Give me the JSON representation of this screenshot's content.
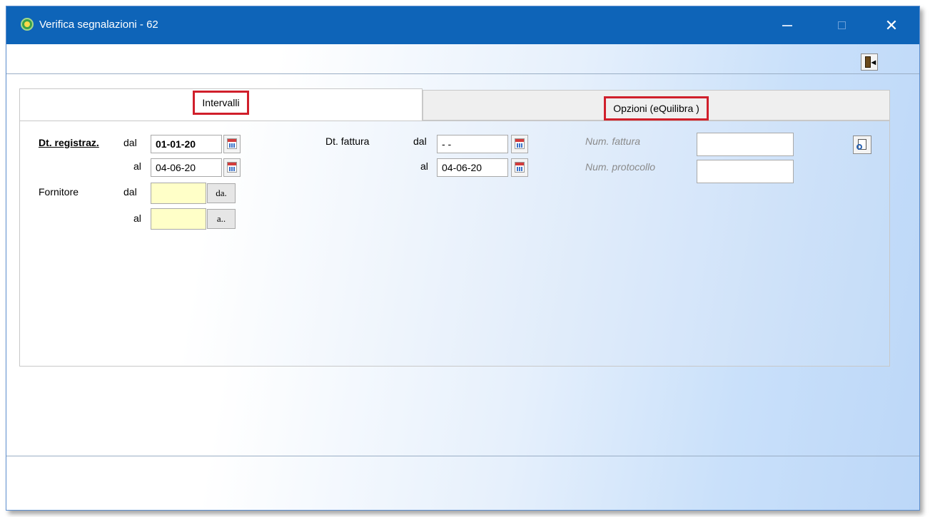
{
  "window": {
    "title": "Verifica segnalazioni - 62",
    "close_glyph": "✕"
  },
  "tabs": [
    {
      "label": "Intervalli",
      "active": true
    },
    {
      "label": "Opzioni (eQuilibra )",
      "active": false
    }
  ],
  "form": {
    "dt_registraz": {
      "label": "Dt. registraz.",
      "dal_label": "dal",
      "al_label": "al",
      "dal_value": "01-01-20",
      "al_value": "04-06-20"
    },
    "dt_fattura": {
      "label": "Dt. fattura",
      "dal_label": "dal",
      "al_label": "al",
      "dal_value": "- -",
      "al_value": "04-06-20"
    },
    "fornitore": {
      "label": "Fornitore",
      "dal_label": "dal",
      "al_label": "al",
      "dal_value": "",
      "al_value": "",
      "dal_button": "da.",
      "al_button": "a.."
    },
    "num_fattura": {
      "label": "Num. fattura",
      "value": ""
    },
    "num_protocollo": {
      "label": "Num. protocollo",
      "value": ""
    }
  },
  "icons": {
    "app": "app-logo-icon",
    "exit": "exit-door-icon",
    "calendar": "calendar-icon",
    "search": "search-document-icon"
  },
  "colors": {
    "titlebar": "#0e64b8",
    "tab_highlight": "#d01f2b",
    "lookup_field": "#ffffc8"
  }
}
